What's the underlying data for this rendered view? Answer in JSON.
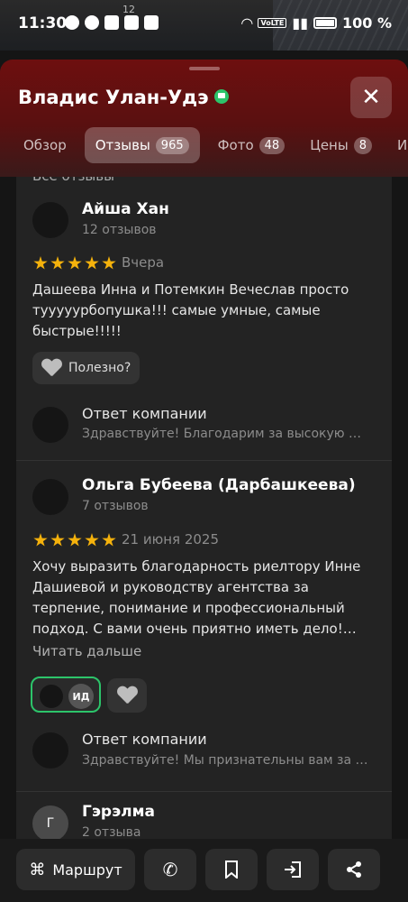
{
  "status_bar": {
    "time": "11:30",
    "small_num": "12",
    "volte": "VoLTE",
    "battery": "100 %"
  },
  "header": {
    "title": "Владис Улан-Удэ",
    "close_label": "✕"
  },
  "tabs": [
    {
      "label": "Обзор",
      "badge": ""
    },
    {
      "label": "Отзывы",
      "badge": "965"
    },
    {
      "label": "Фото",
      "badge": "48"
    },
    {
      "label": "Цены",
      "badge": "8"
    },
    {
      "label": "Ин",
      "badge": ""
    }
  ],
  "content": {
    "cut_text": "Все отзывы",
    "reviews": [
      {
        "name": "Айша Хан",
        "count": "12 отзывов",
        "stars": 5,
        "date": "Вчера",
        "text": "Дашеева Инна и Потемкин Вечеслав просто тууууурбопушка!!! самые умные, самые быстрые!!!!!",
        "helpful_label": "Полезно?",
        "reply_title": "Ответ компании",
        "reply_text": "Здравствуйте! Благодарим за высокую …"
      },
      {
        "name": "Ольга Бубеева (Дарбашкеева)",
        "count": "7 отзывов",
        "stars": 5,
        "date": "21 июня 2025",
        "text": "Хочу выразить благодарность риелтору Инне Дашиевой и руководству агентства за терпение, понимание и профессиональный подход. С вами очень приятно иметь дело!…",
        "read_more": "Читать дальше",
        "reactor_initials": "ИД",
        "reply_title": "Ответ компании",
        "reply_text": "Здравствуйте! Мы признательны вам за …"
      },
      {
        "name": "Гэрэлма",
        "count": "2 отзыва",
        "avatar_letter": "Г"
      }
    ]
  },
  "bottom_bar": {
    "route_label": "Маршрут"
  },
  "colors": {
    "accent_green": "#2cc46a",
    "star": "#f5b20c",
    "header_red": "#6d0f0f"
  }
}
